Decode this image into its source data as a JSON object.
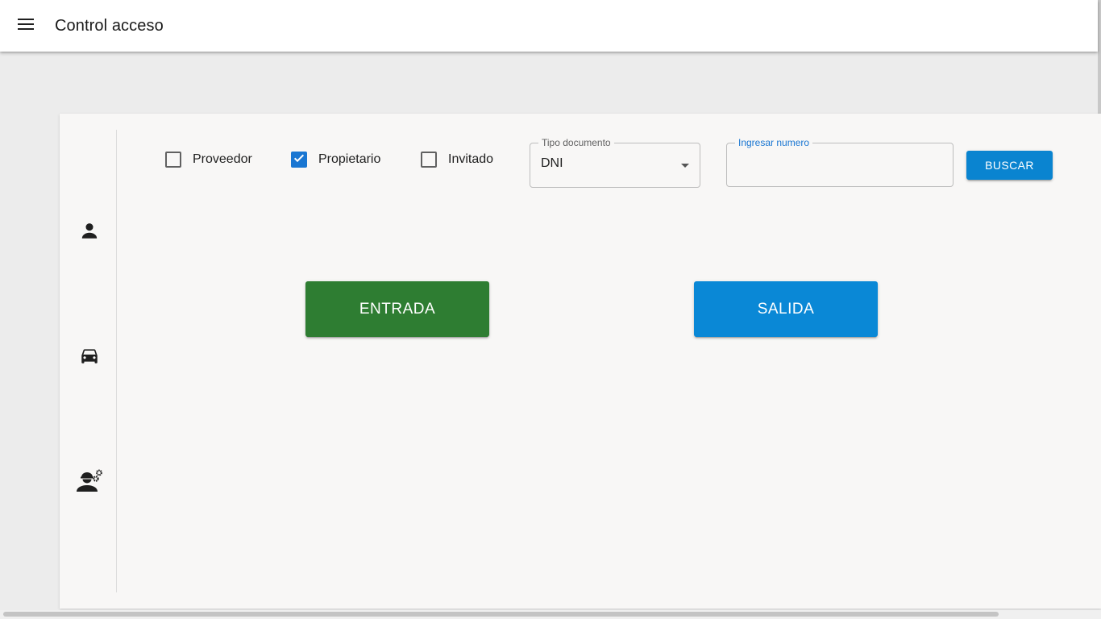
{
  "app": {
    "title": "Control acceso"
  },
  "icons": {
    "menu": "menu-icon",
    "rail": [
      "person-icon",
      "car-icon",
      "engineer-icon"
    ]
  },
  "filters": {
    "checkboxes": [
      {
        "label": "Proveedor",
        "checked": false
      },
      {
        "label": "Propietario",
        "checked": true
      },
      {
        "label": "Invitado",
        "checked": false
      }
    ],
    "doc_type": {
      "label": "Tipo documento",
      "value": "DNI"
    },
    "number": {
      "label": "Ingresar numero",
      "value": ""
    },
    "search_label": "BUSCAR"
  },
  "actions": {
    "entrada_label": "ENTRADA",
    "salida_label": "SALIDA"
  },
  "colors": {
    "primary": "#1976d2",
    "search_button": "#0a84d0",
    "entrada": "#2e7d32",
    "salida": "#0a88d6",
    "label_focus": "#1976d2",
    "label_muted": "#616161"
  }
}
